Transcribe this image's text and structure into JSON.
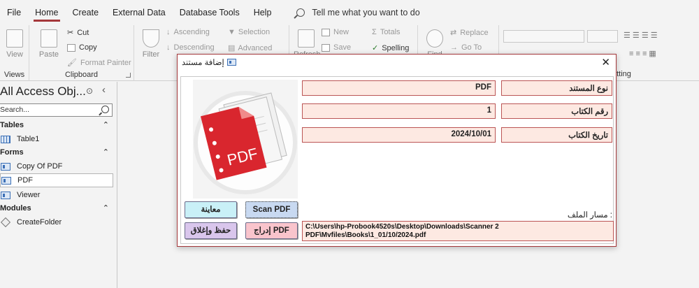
{
  "menu": {
    "items": [
      "File",
      "Home",
      "Create",
      "External Data",
      "Database Tools",
      "Help"
    ],
    "active": "Home",
    "tell_me": "Tell me what you want to do"
  },
  "ribbon": {
    "views": {
      "view_label": "View",
      "group_label": "Views"
    },
    "clipboard": {
      "paste_label": "Paste",
      "cut_label": "Cut",
      "copy_label": "Copy",
      "format_painter_label": "Format Painter",
      "group_label": "Clipboard"
    },
    "sort_filter": {
      "filter_label": "Filter",
      "ascending_label": "Ascending",
      "descending_label": "Descending",
      "selection_label": "Selection",
      "advanced_label": "Advanced"
    },
    "records": {
      "refresh_label": "Refresh",
      "new_label": "New",
      "save_label": "Save",
      "totals_label": "Totals",
      "spelling_label": "Spelling"
    },
    "find": {
      "find_label": "Find",
      "replace_label": "Replace",
      "goto_label": "Go To"
    },
    "text_formatting": {
      "group_label_partial": "atting"
    }
  },
  "nav_pane": {
    "title": "All Access Obj...",
    "search_placeholder": "Search...",
    "groups": [
      {
        "label": "Tables",
        "items": [
          {
            "label": "Table1",
            "type": "table"
          }
        ]
      },
      {
        "label": "Forms",
        "items": [
          {
            "label": "Copy Of PDF",
            "type": "form"
          },
          {
            "label": "PDF",
            "type": "form",
            "selected": true
          },
          {
            "label": "Viewer",
            "type": "form"
          }
        ]
      },
      {
        "label": "Modules",
        "items": [
          {
            "label": "CreateFolder",
            "type": "module"
          }
        ]
      }
    ]
  },
  "dialog": {
    "title": "إضافة مستند",
    "close_glyph": "✕",
    "fields": {
      "doc_type": {
        "label": "نوع المستند",
        "value": "PDF"
      },
      "book_no": {
        "label": "رقم الكتاب",
        "value": "1"
      },
      "book_date": {
        "label": "تاريخ الكتاب",
        "value": "2024/10/01"
      }
    },
    "path_label": "مسار الملف :",
    "path_line1": "C:\\Users\\hp-Probook4520s\\Desktop\\Downloads\\Scanner 2",
    "path_line2": "PDF\\Mvfiles\\Books\\1_01/10/2024.pdf",
    "pdf_badge": "PDF",
    "buttons": {
      "preview": "معاينة",
      "scan": "Scan PDF",
      "save_close": "حفظ وإغلاق",
      "insert": "إدراج PDF"
    }
  },
  "colors": {
    "accent": "#a4373a",
    "field_bg": "#fde9e2",
    "pdf_red": "#d9262e"
  }
}
